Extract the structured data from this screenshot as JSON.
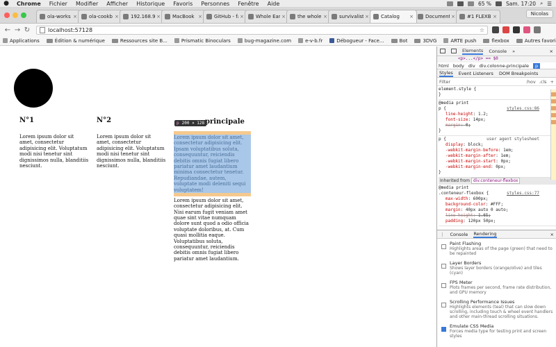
{
  "menubar": {
    "app": "Chrome",
    "items": [
      "Fichier",
      "Modifier",
      "Afficher",
      "Historique",
      "Favoris",
      "Personnes",
      "Fenêtre",
      "Aide"
    ],
    "battery": "65 %",
    "clock": "Sam. 17:20"
  },
  "tabs": [
    {
      "label": "ola-works"
    },
    {
      "label": "ola-cookb"
    },
    {
      "label": "192.168.9"
    },
    {
      "label": "MacBook"
    },
    {
      "label": "GitHub - fa"
    },
    {
      "label": "Whole Ear"
    },
    {
      "label": "the whole"
    },
    {
      "label": "survivalist"
    },
    {
      "label": "Catalog",
      "active": true
    },
    {
      "label": "Document"
    },
    {
      "label": "#1 FLEXB"
    }
  ],
  "profile": "Nicolas",
  "address": "localhost:57128",
  "bookmarks": [
    "Applications",
    "Édition & numérique",
    "Ressources site B...",
    "Prismatic Binoculars",
    "bug-magazine.com",
    "e-v-b.fr",
    "Débogueur - Face...",
    "Bot",
    "3DVG",
    "ARTE push",
    "flexbox"
  ],
  "bookmarks_more": "Autres favoris",
  "page": {
    "col1": {
      "title": "N°1",
      "text": "Lorem ipsum dolor sit amet, consectetur adipisicing elit. Voluptatum modi nisi tenetur sint dignissimos nulla, blanditiis nesciunt."
    },
    "col2": {
      "title": "N°2",
      "text": "Lorem ipsum dolor sit amet, consectetur adipisicing elit. Voluptatum modi nisi tenetur sint dignissimos nulla, blanditiis nesciunt."
    },
    "col3": {
      "title": "principale",
      "highlight_text": "Lorem ipsum dolor sit amet, consectetur adipisicing elit. Ipsam voluptatibus soluta, consequuntur, reiciendis debitis omnis fugiat libero pariatur amet laudantium minima consectetur tenetur. Repudiandae, autem, voluptate modi deleniti sequi voluptatem!",
      "text": "Lorem ipsum dolor sit amet, consectetur adipisicing elit. Nisi earum fugit veniam amet quae sint vitae numquam dolore sunt quod a odio officia voluptate doloribus, at. Cum quasi mollitia eaque. Voluptatibus soluta, consequuntur, reiciendis debitis omnis fugiat libero pariatur amet laudantium."
    },
    "tooltip": {
      "tag": "p",
      "size": "200 × 128"
    }
  },
  "devtools": {
    "tabs": [
      "Elements",
      "Console"
    ],
    "more": "»",
    "dom_line": "<p>...</p> == $0",
    "breadcrumb": [
      "html",
      "body",
      "div",
      "div.colonne-principale",
      "p"
    ],
    "subtabs": [
      "Styles",
      "Event Listeners",
      "DOM Breakpoints"
    ],
    "filter": {
      "label": "Filter",
      "hov": ":hov",
      "cls": ".cls",
      "plus": "+"
    },
    "element_style": "element.style {",
    "media1": "@media print",
    "rule1": {
      "selector": "p {",
      "source": "styles.css:86",
      "props": [
        {
          "name": "line-height",
          "value": "1.2;"
        },
        {
          "name": "font-size",
          "value": "14px;"
        },
        {
          "name": "margin",
          "value": "0;",
          "struck": true
        }
      ]
    },
    "rule2": {
      "selector": "p {",
      "source": "user agent stylesheet",
      "props": [
        {
          "name": "display",
          "value": "block;"
        },
        {
          "name": "-webkit-margin-before",
          "value": "1em;"
        },
        {
          "name": "-webkit-margin-after",
          "value": "1em;"
        },
        {
          "name": "-webkit-margin-start",
          "value": "0px;"
        },
        {
          "name": "-webkit-margin-end",
          "value": "0px;"
        }
      ]
    },
    "inherited_label": "Inherited from",
    "inherited_tag": "div.conteneur-flexbox",
    "media2": "@media print",
    "rule3": {
      "selector": ".conteneur-flexbox {",
      "source": "styles.css:77",
      "props": [
        {
          "name": "max-width",
          "value": "600px;"
        },
        {
          "name": "background-color",
          "value": "#FFF;"
        },
        {
          "name": "margin",
          "value": "40px auto 0 auto;"
        },
        {
          "name": "line-height",
          "value": "1.65;",
          "struck": true
        },
        {
          "name": "padding",
          "value": "120px 50px;"
        }
      ]
    },
    "drawer": {
      "tabs": [
        "Console",
        "Rendering"
      ],
      "options": [
        {
          "title": "Paint Flashing",
          "desc": "Highlights areas of the page (green) that need to be repainted",
          "checked": false
        },
        {
          "title": "Layer Borders",
          "desc": "Shows layer borders (orange/olive) and tiles (cyan)",
          "checked": false
        },
        {
          "title": "FPS Meter",
          "desc": "Plots frames per second, frame rate distribution, and GPU memory",
          "checked": false
        },
        {
          "title": "Scrolling Performance Issues",
          "desc": "Highlights elements (teal) that can slow down scrolling, including touch & wheel event handlers and other main-thread scrolling situations.",
          "checked": false
        },
        {
          "title": "Emulate CSS Media",
          "desc": "Forces media type for testing print and screen styles",
          "checked": true
        }
      ]
    }
  },
  "colors": {
    "highlight_content": "#a9c7e8",
    "highlight_margin": "#f5c98e",
    "devtools_accent": "#3879d9"
  }
}
